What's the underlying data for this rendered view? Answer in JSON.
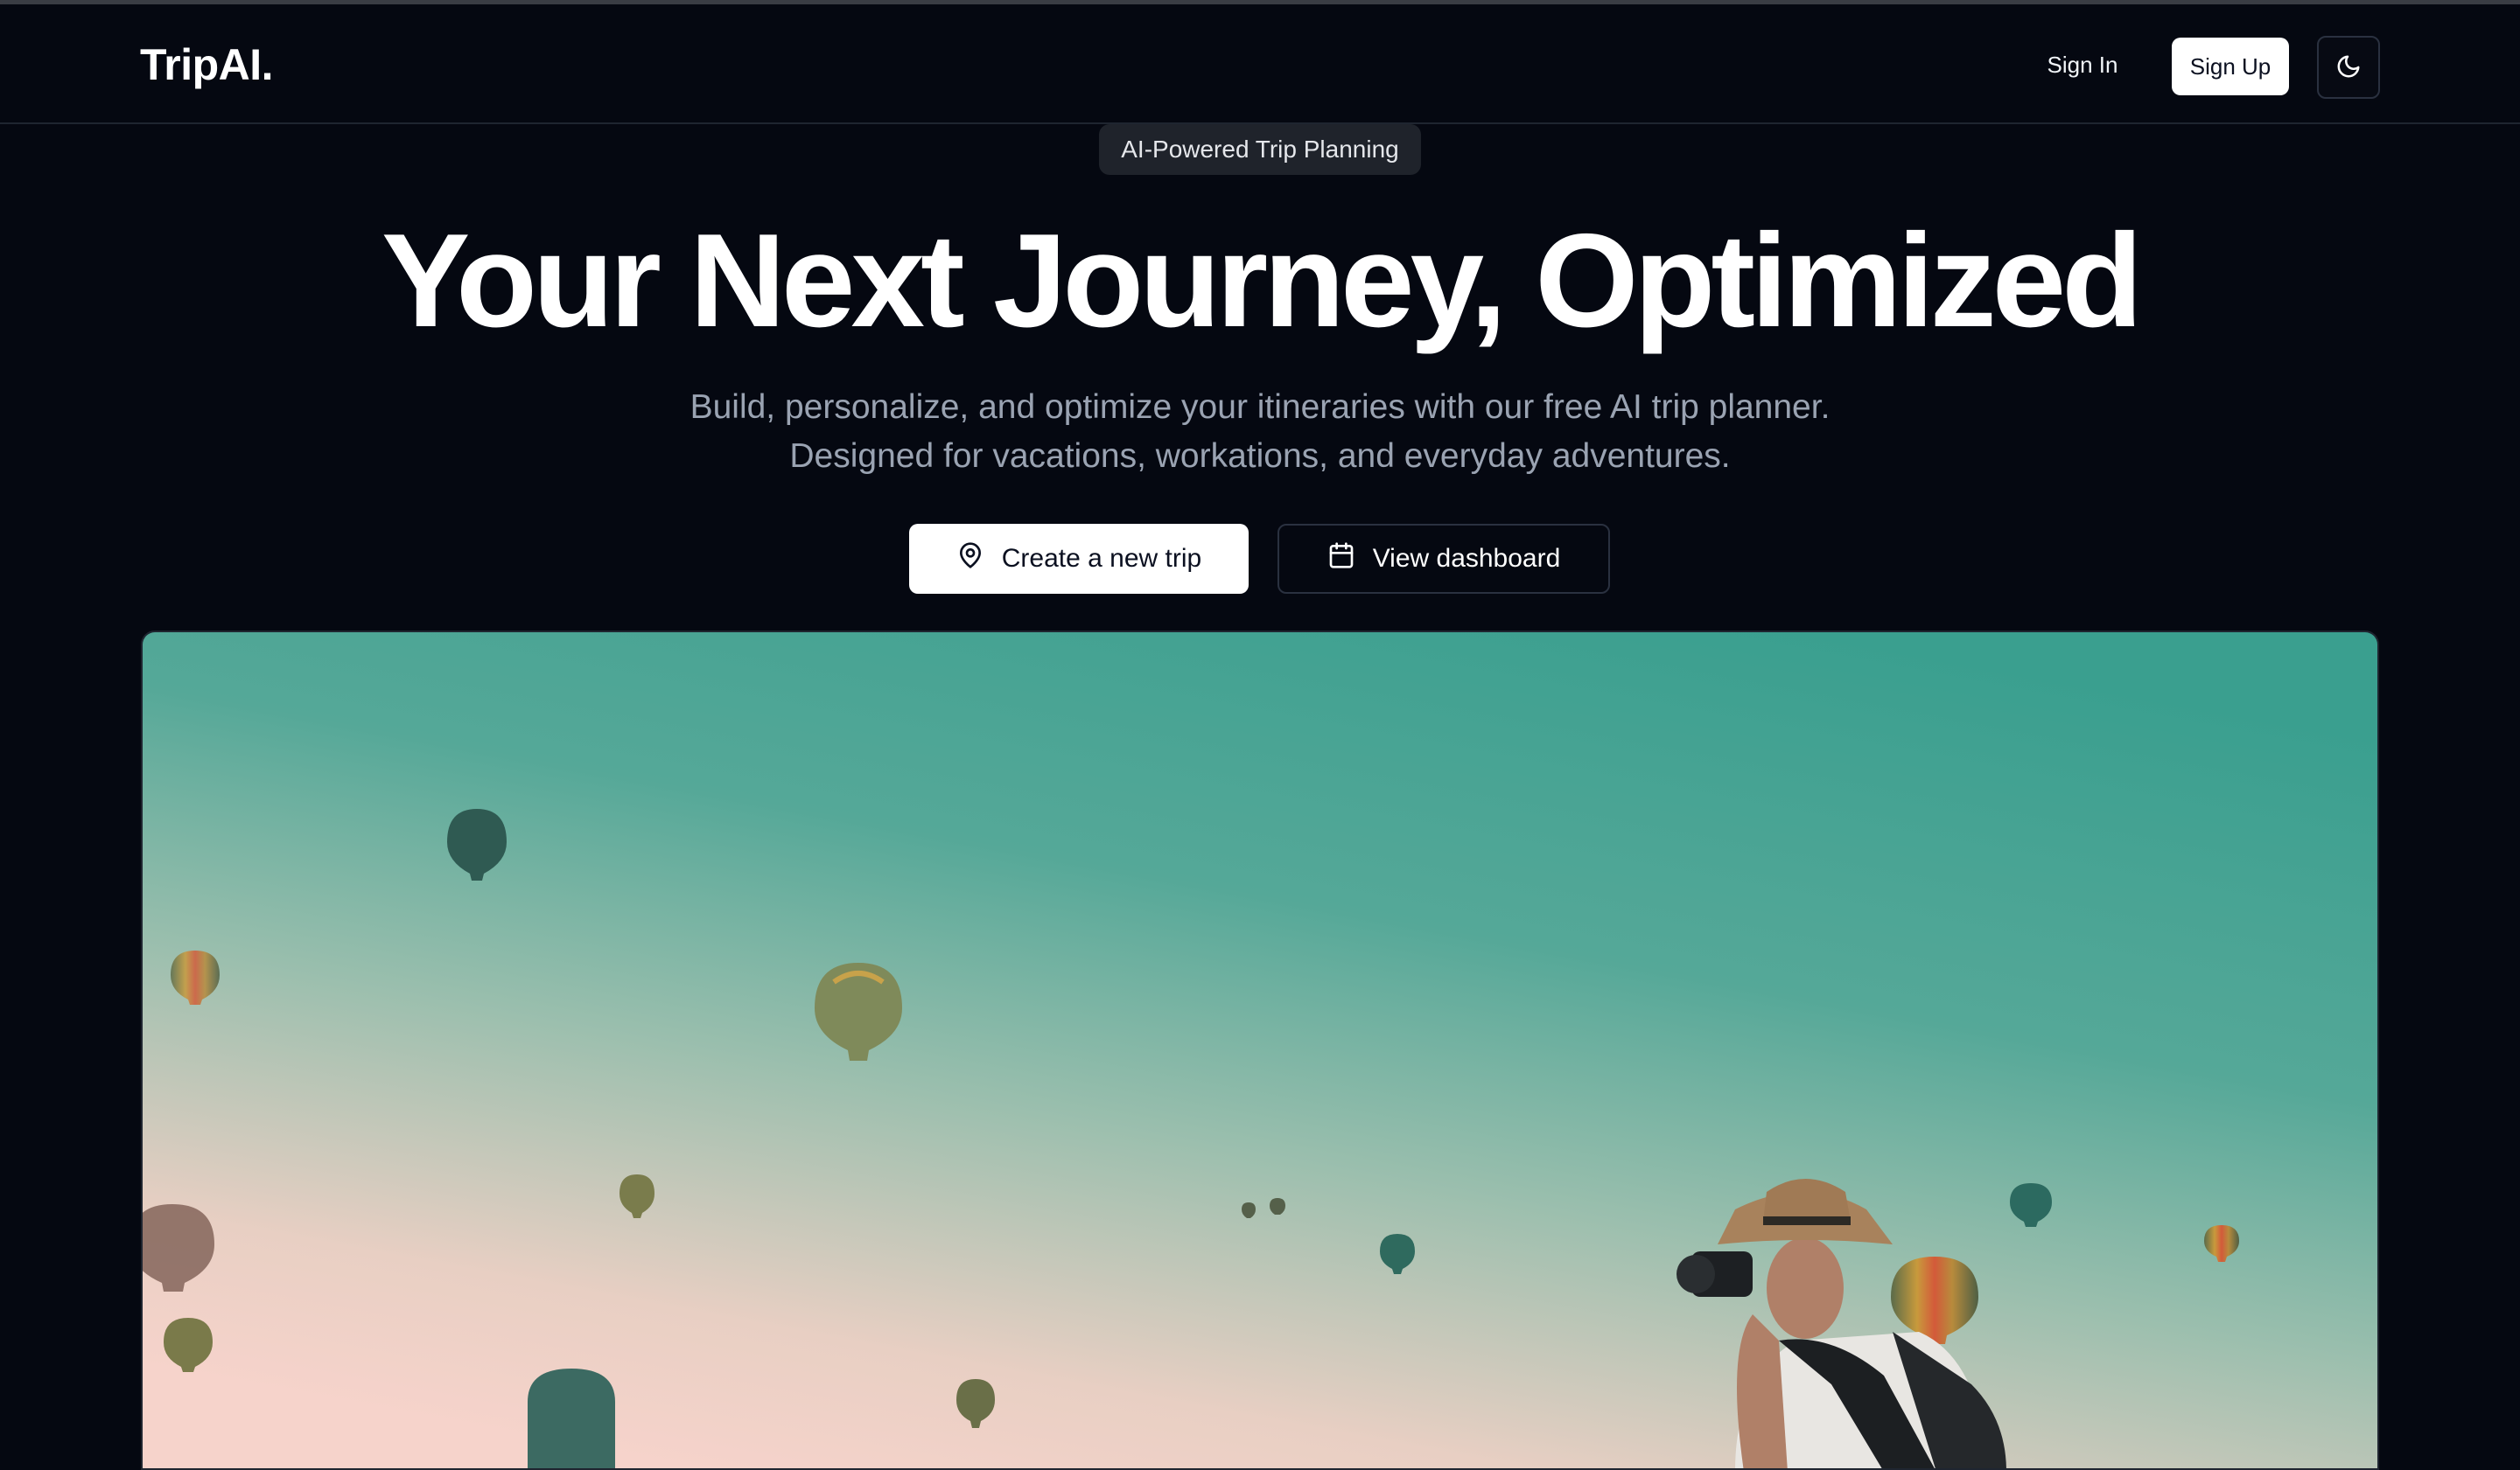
{
  "header": {
    "logo": "TripAI.",
    "sign_in": "Sign In",
    "sign_up": "Sign Up",
    "theme_icon": "moon-icon"
  },
  "hero": {
    "badge": "AI-Powered Trip Planning",
    "title": "Your Next Journey, Optimized",
    "subtitle_line1": "Build, personalize, and optimize your itineraries with our free AI trip planner.",
    "subtitle_line2": "Designed for vacations, workations, and everyday adventures.",
    "primary_button": "Create a new trip",
    "primary_icon": "map-pin-icon",
    "secondary_button": "View dashboard",
    "secondary_icon": "calendar-icon",
    "image": "hot-air-balloons-photographer"
  },
  "colors": {
    "background": "#050811",
    "sky_top": "#3fa293",
    "sky_bottom": "#f3d2c9",
    "button_primary": "#ffffff"
  }
}
